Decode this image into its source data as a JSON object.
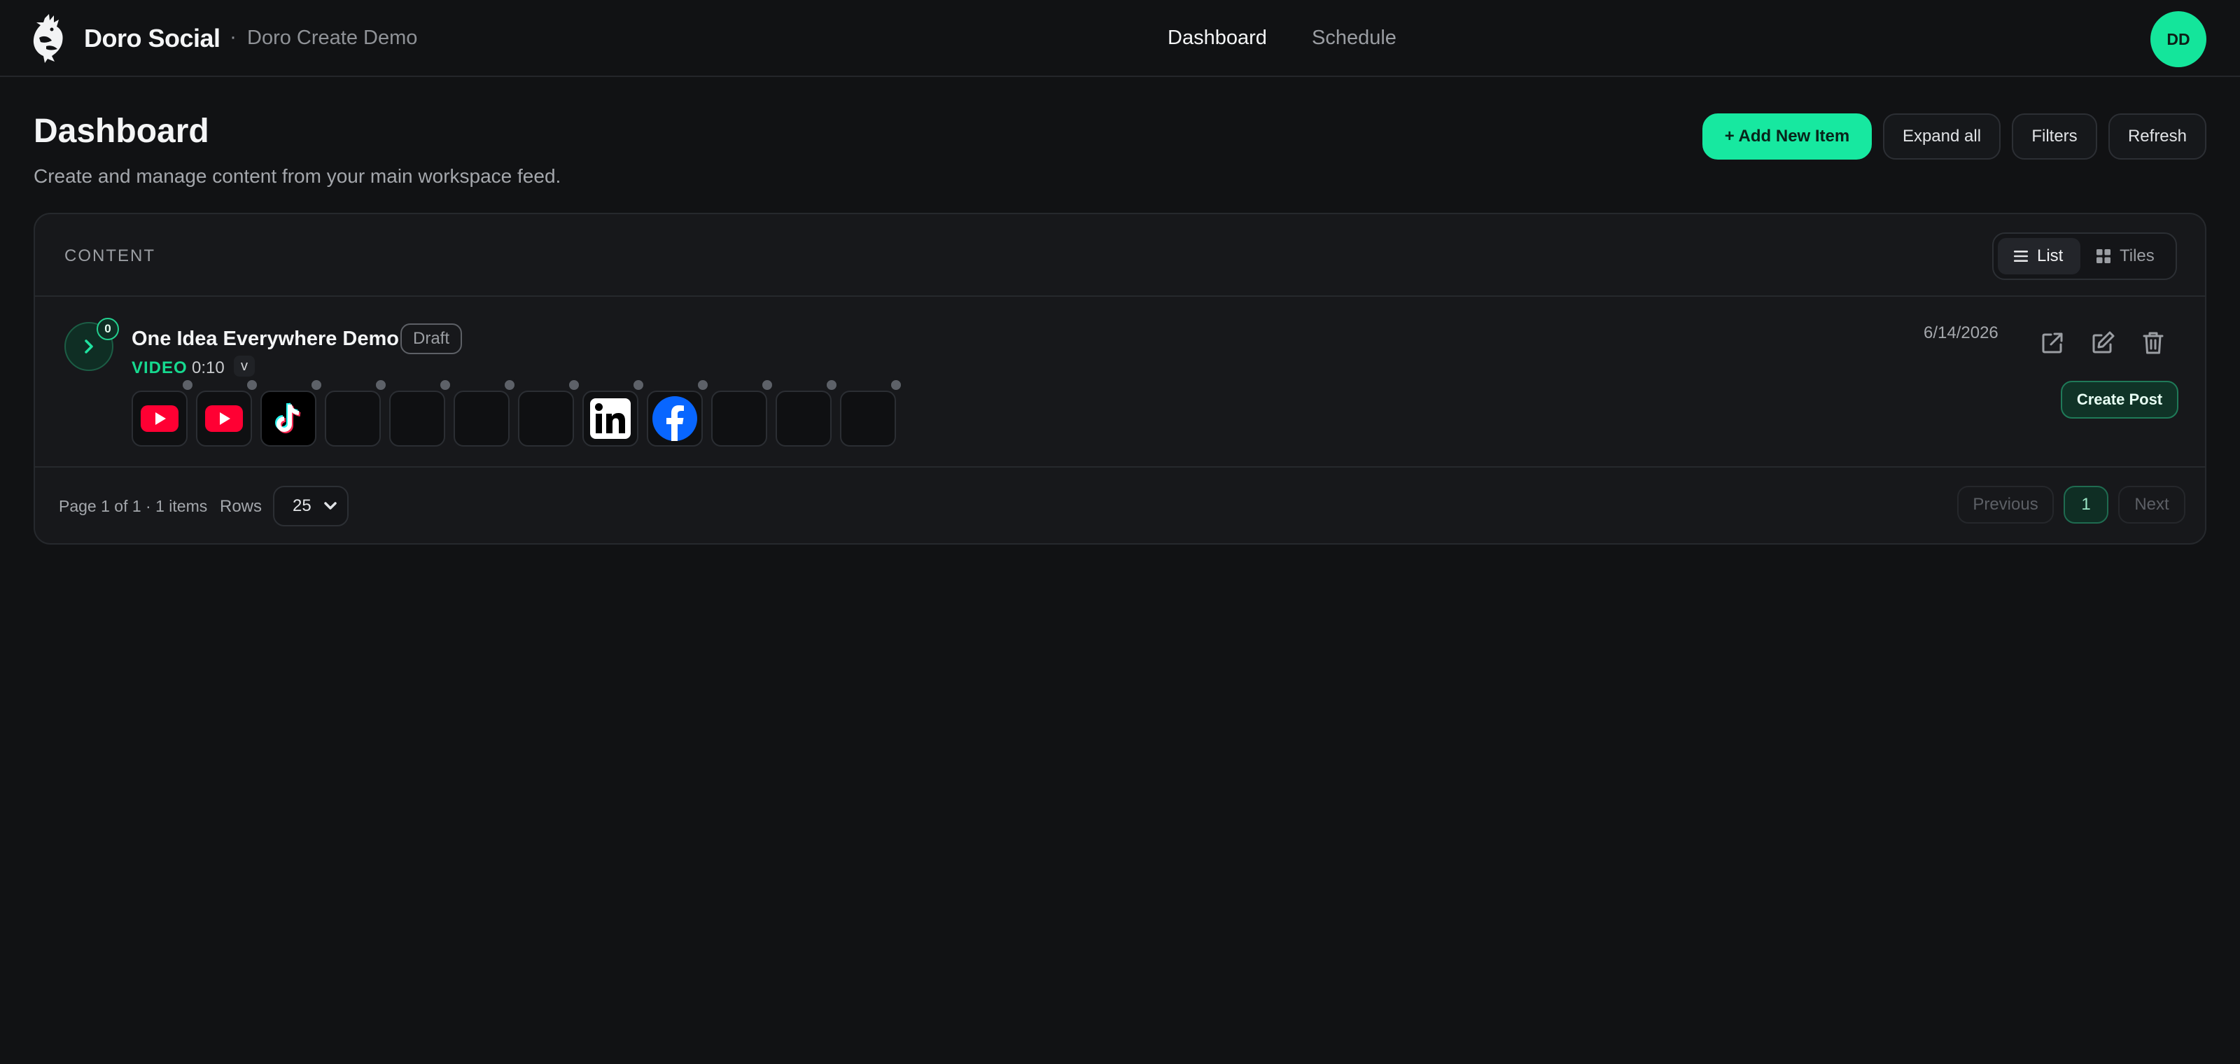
{
  "header": {
    "brand": "Doro Social",
    "separator": "·",
    "workspace": "Doro Create Demo",
    "nav": [
      {
        "label": "Dashboard",
        "active": true
      },
      {
        "label": "Schedule",
        "active": false
      }
    ],
    "avatar_initials": "DD"
  },
  "page": {
    "title": "Dashboard",
    "subtitle": "Create and manage content from your main workspace feed.",
    "actions": {
      "add": "+ Add New Item",
      "expand": "Expand all",
      "filters": "Filters",
      "refresh": "Refresh"
    }
  },
  "content": {
    "section_label": "CONTENT",
    "view_toggle": {
      "list": "List",
      "tiles": "Tiles",
      "selected": "list"
    },
    "items": [
      {
        "posts_count": "0",
        "title": "One Idea Everywhere Demo",
        "status": "Draft",
        "media_type": "VIDEO",
        "duration": "0:10",
        "version": "v",
        "date": "6/14/2026",
        "create_post_label": "Create Post",
        "platform_slots": [
          "youtube-icon",
          "youtube-icon",
          "tiktok-icon",
          "empty",
          "empty",
          "empty",
          "empty",
          "linkedin-icon",
          "facebook-icon",
          "empty",
          "empty",
          "empty"
        ]
      }
    ]
  },
  "pagination": {
    "summary": "Page 1 of 1 · 1 items",
    "rows_label": "Rows",
    "rows_value": "25",
    "previous": "Previous",
    "current": "1",
    "next": "Next"
  },
  "colors": {
    "background": "#111214",
    "accent": "#17e8a0",
    "media_type": "#16d98f",
    "youtube": "#ff0033",
    "facebook": "#0866ff"
  }
}
